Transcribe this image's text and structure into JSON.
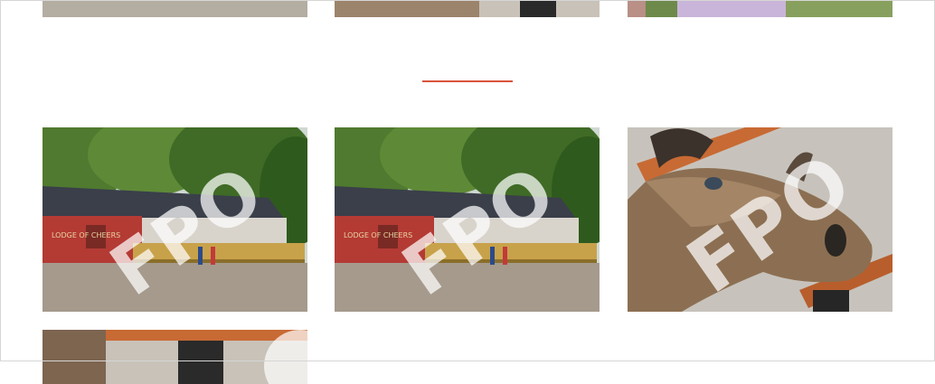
{
  "colors": {
    "divider": "#d9533a",
    "background": "#ffffff"
  },
  "watermark": "FPO",
  "gallery": {
    "top_row": [
      {
        "subject": "cabin-photo"
      },
      {
        "subject": "moose-photo"
      },
      {
        "subject": "person-photo"
      }
    ],
    "main_row": [
      {
        "subject": "cabin-photo",
        "sign": "LODGE OF CHEERS"
      },
      {
        "subject": "cabin-photo",
        "sign": "LODGE OF CHEERS"
      },
      {
        "subject": "moose-photo"
      }
    ],
    "bottom_row": [
      {
        "subject": "moose-photo"
      }
    ]
  }
}
